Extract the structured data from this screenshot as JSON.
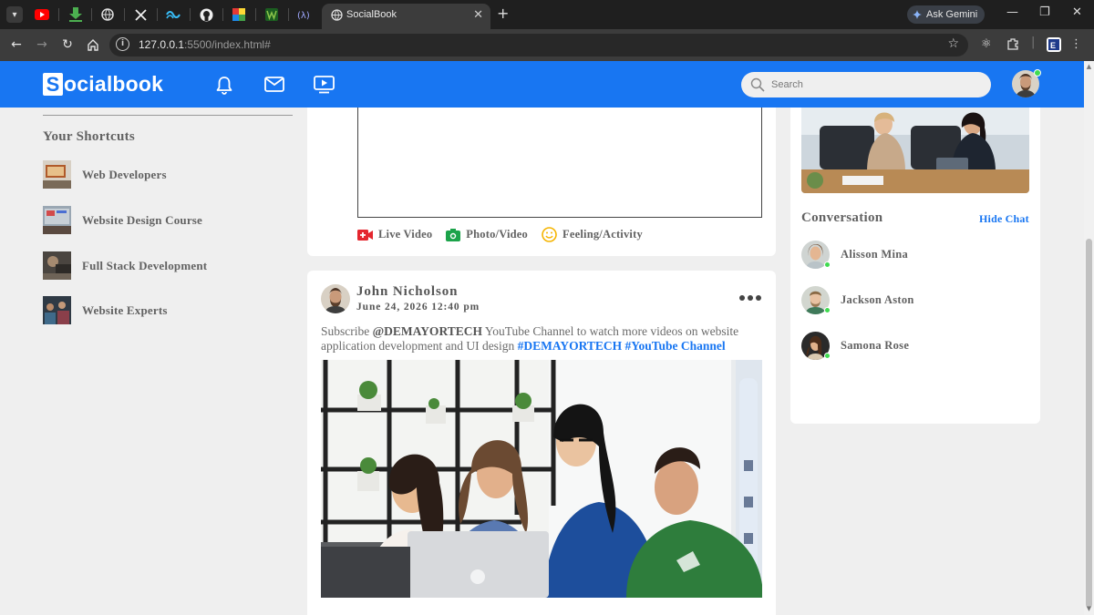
{
  "browser": {
    "tab_title": "SocialBook",
    "url_host": "127.0.0.1",
    "url_path": ":5500/index.html#",
    "gemini_label": "Ask Gemini",
    "window_minimize": "—",
    "window_restore": "❐",
    "window_close": "✕"
  },
  "navbar": {
    "logo_letter": "S",
    "logo_rest": "ocialbook",
    "search_placeholder": "Search"
  },
  "sidebar": {
    "shortcuts_title": "Your Shortcuts",
    "shortcuts": [
      {
        "label": "Web Developers"
      },
      {
        "label": "Website Design Course"
      },
      {
        "label": "Full Stack Development"
      },
      {
        "label": "Website Experts"
      }
    ]
  },
  "composer": {
    "actions": [
      {
        "label": "Live Video",
        "icon": "live-video-icon",
        "color": "#e4262e"
      },
      {
        "label": "Photo/Video",
        "icon": "photo-icon",
        "color": "#1ca34a"
      },
      {
        "label": "Feeling/Activity",
        "icon": "smiley-icon",
        "color": "#f5b400"
      }
    ]
  },
  "post": {
    "author": "John Nicholson",
    "time": "June 24, 2026 12:40 pm",
    "text_before": "Subscribe ",
    "mention": "@DEMAYORTECH",
    "text_after": " YouTube Channel to watch more videos on website application development and UI design ",
    "tags": "#DEMAYORTECH #YouTube Channel"
  },
  "right": {
    "conversation_title": "Conversation",
    "hide_chat": "Hide Chat",
    "contacts": [
      {
        "name": "Alisson Mina",
        "online": true
      },
      {
        "name": "Jackson Aston",
        "online": true
      },
      {
        "name": "Samona Rose",
        "online": true
      }
    ]
  },
  "colors": {
    "brand": "#1876f2",
    "online": "#41db51",
    "background": "#efefef"
  }
}
